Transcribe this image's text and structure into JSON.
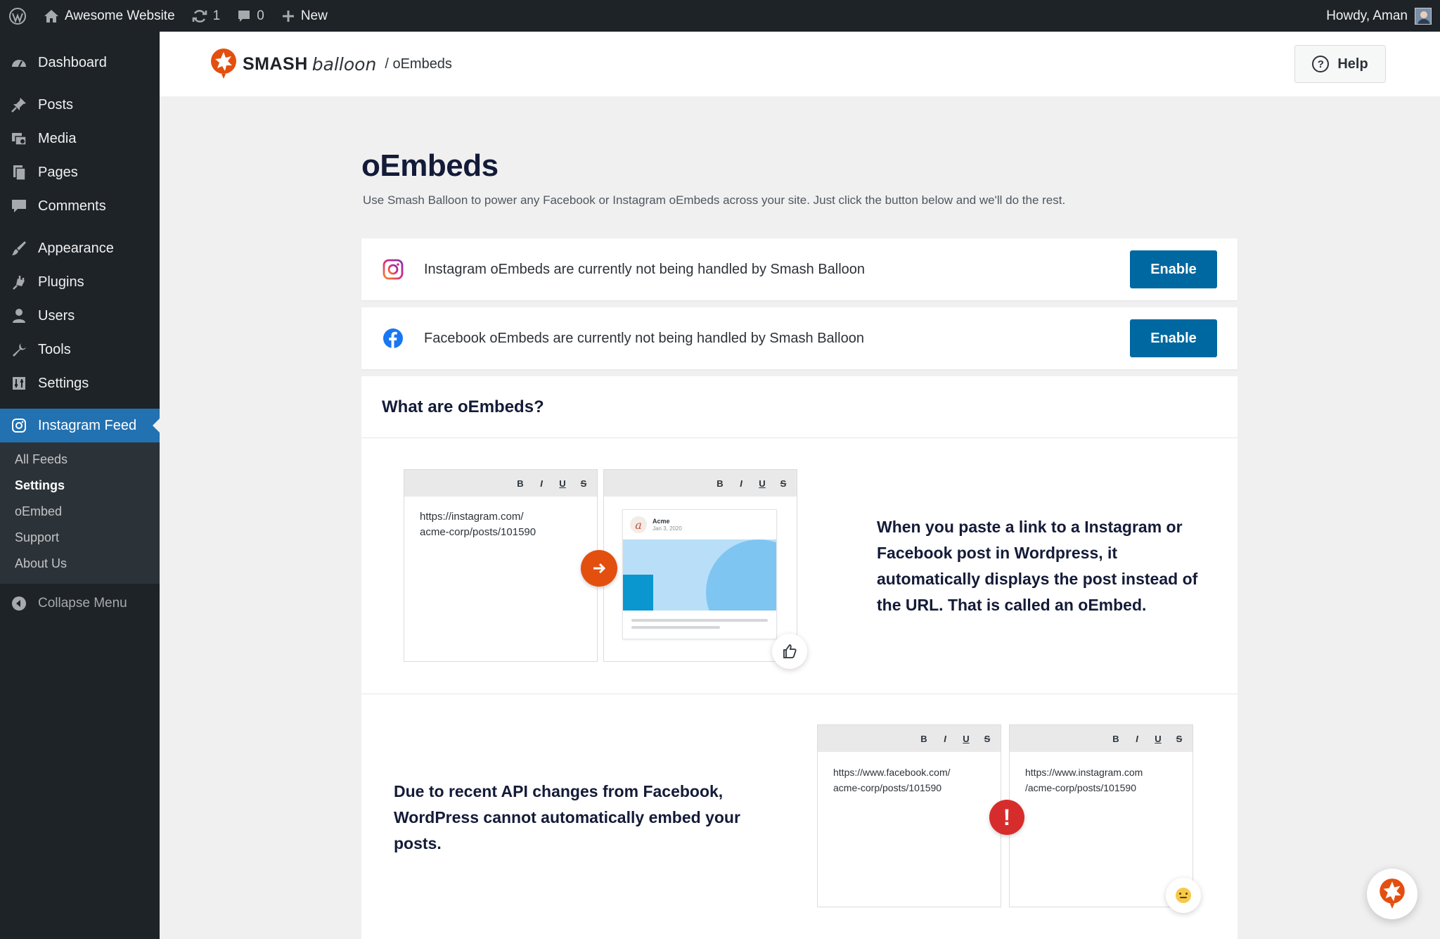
{
  "adminbar": {
    "site_name": "Awesome Website",
    "updates_count": "1",
    "comments_count": "0",
    "new_label": "New",
    "greeting": "Howdy, Aman"
  },
  "sidebar": {
    "items": [
      {
        "label": "Dashboard",
        "icon": "dashboard-icon"
      },
      {
        "label": "Posts",
        "icon": "pin-icon"
      },
      {
        "label": "Media",
        "icon": "media-icon"
      },
      {
        "label": "Pages",
        "icon": "pages-icon"
      },
      {
        "label": "Comments",
        "icon": "comment-icon"
      },
      {
        "label": "Appearance",
        "icon": "brush-icon"
      },
      {
        "label": "Plugins",
        "icon": "plugin-icon"
      },
      {
        "label": "Users",
        "icon": "user-icon"
      },
      {
        "label": "Tools",
        "icon": "wrench-icon"
      },
      {
        "label": "Settings",
        "icon": "settings-icon"
      }
    ],
    "active": {
      "label": "Instagram Feed",
      "icon": "instagram-icon"
    },
    "submenu": [
      "All Feeds",
      "Settings",
      "oEmbed",
      "Support",
      "About Us"
    ],
    "submenu_current": "Settings",
    "collapse_label": "Collapse Menu"
  },
  "header": {
    "brand_word1": "SMASH",
    "brand_word2": "balloon",
    "breadcrumb": "/ oEmbeds",
    "help_label": "Help"
  },
  "main": {
    "title": "oEmbeds",
    "description": "Use Smash Balloon to power any Facebook or Instagram oEmbeds across your site. Just click the button below and we'll do the rest.",
    "notices": [
      {
        "icon": "instagram-icon",
        "text": "Instagram oEmbeds are currently not being handled by Smash Balloon",
        "button": "Enable"
      },
      {
        "icon": "facebook-icon",
        "text": "Facebook oEmbeds are currently not being handled by Smash Balloon",
        "button": "Enable"
      }
    ],
    "what": {
      "heading": "What are oEmbeds?",
      "toolbar": [
        "B",
        "I",
        "U",
        "S"
      ],
      "example1": {
        "url_line1": "https://instagram.com/",
        "url_line2": "acme-corp/posts/101590",
        "card_name": "Acme",
        "card_date": "Jan 3, 2020",
        "text": "When you paste a link to a Instagram or Facebook post in Wordpress, it automatically displays the post instead of the URL. That is called an oEmbed."
      },
      "example2": {
        "text": "Due to recent API changes from Facebook, WordPress cannot automatically embed your posts.",
        "url1_line1": "https://www.facebook.com/",
        "url1_line2": "acme-corp/posts/101590",
        "url2_line1": "https://www.instagram.com",
        "url2_line2": "/acme-corp/posts/101590"
      }
    }
  },
  "colors": {
    "admin_dark": "#1d2327",
    "active_blue": "#2271b1",
    "button_blue": "#0068a0",
    "brand_orange": "#e34f0e",
    "error_red": "#d72c2c"
  }
}
